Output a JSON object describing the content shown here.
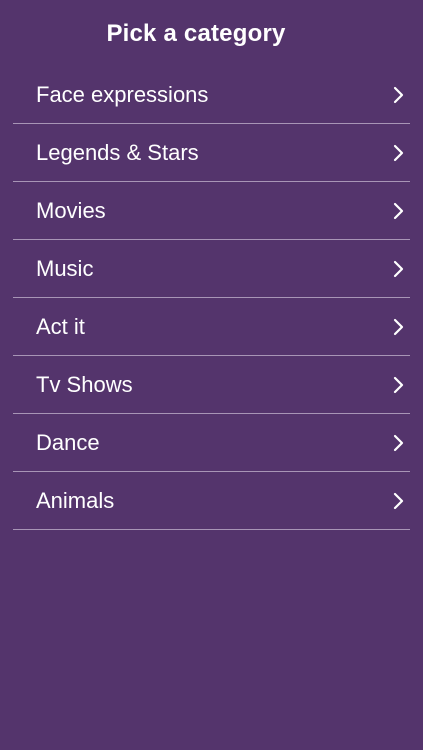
{
  "header": {
    "title": "Pick a category"
  },
  "categories": [
    {
      "label": "Face expressions",
      "icon": "chevron-right-icon"
    },
    {
      "label": "Legends & Stars",
      "icon": "chevron-right-icon"
    },
    {
      "label": "Movies",
      "icon": "chevron-right-icon"
    },
    {
      "label": "Music",
      "icon": "chevron-right-icon"
    },
    {
      "label": "Act it",
      "icon": "chevron-right-icon"
    },
    {
      "label": "Tv Shows",
      "icon": "chevron-right-icon"
    },
    {
      "label": "Dance",
      "icon": "chevron-right-icon"
    },
    {
      "label": "Animals",
      "icon": "chevron-right-icon"
    }
  ],
  "colors": {
    "background": "#54346c",
    "text": "#ffffff",
    "divider": "#a895b6"
  }
}
